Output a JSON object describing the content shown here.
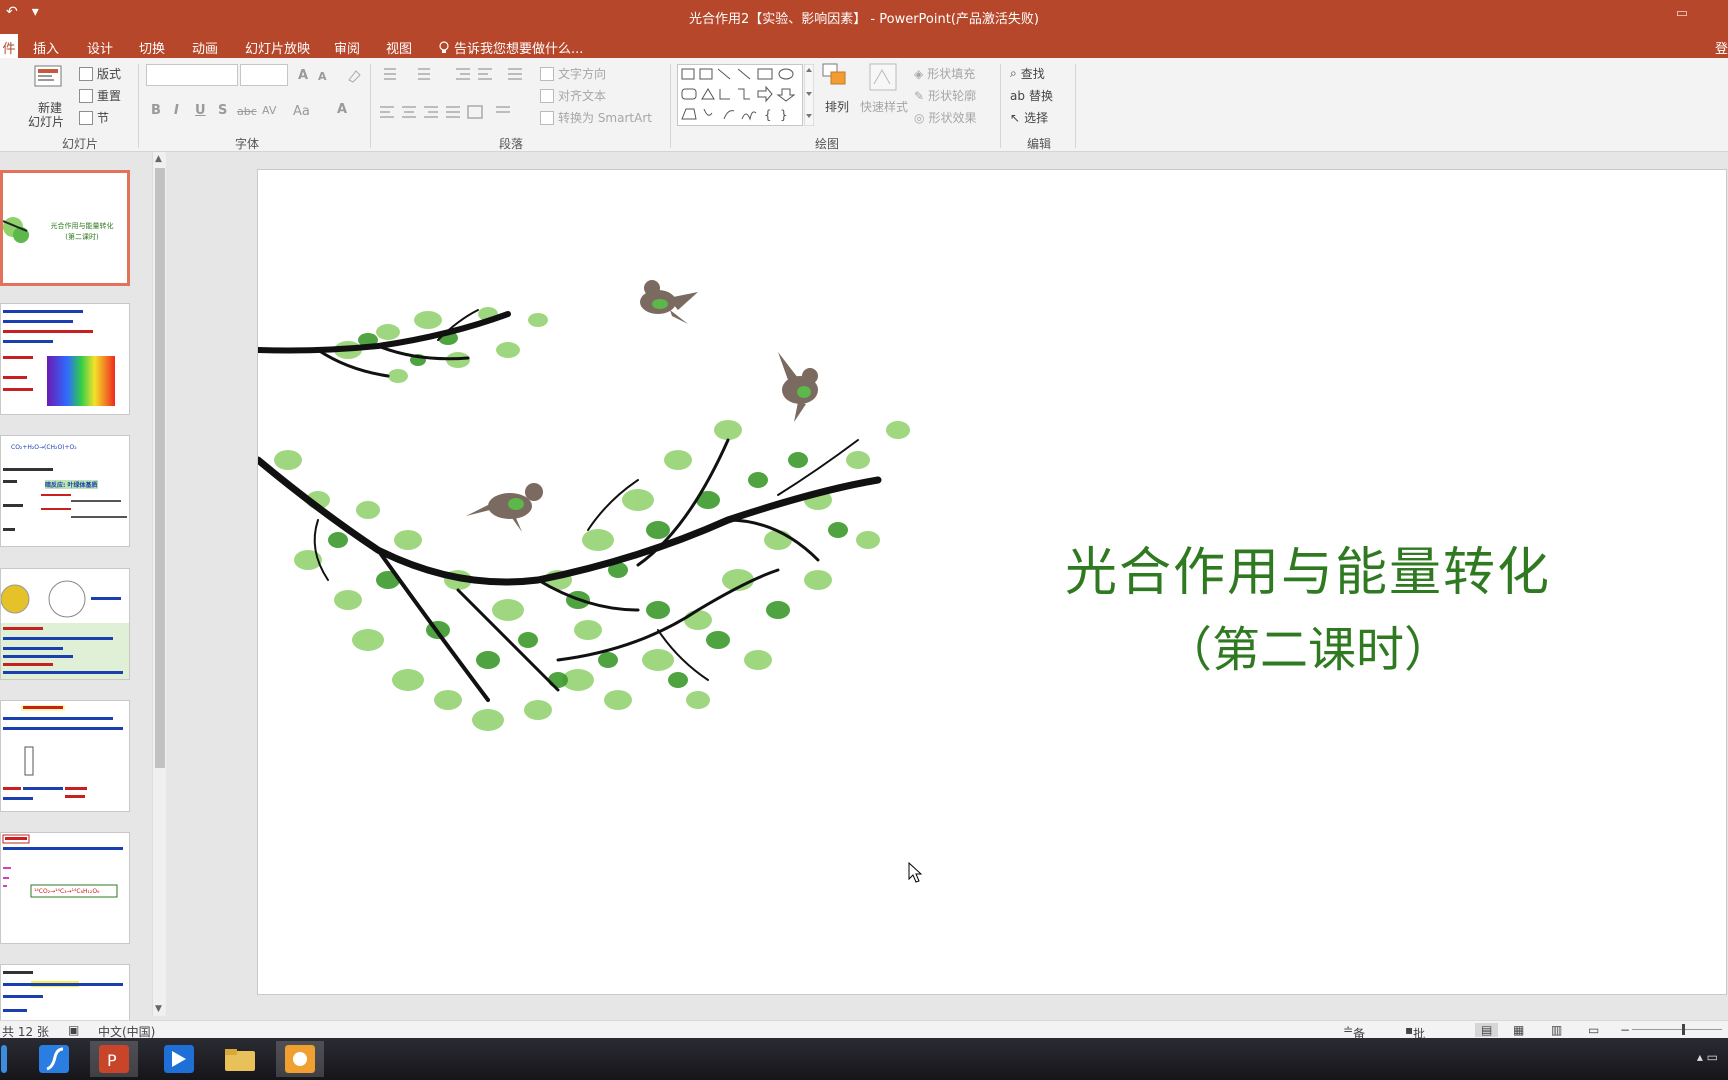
{
  "window": {
    "title": "光合作用2【实验、影响因素】 - PowerPoint(产品激活失败)",
    "qat_undo": "↶",
    "qat_more": "▾",
    "window_ctrl": "▭"
  },
  "tabs": {
    "active_partial": "件",
    "items": [
      "插入",
      "设计",
      "切换",
      "动画",
      "幻灯片放映",
      "审阅",
      "视图"
    ],
    "tell_me": "告诉我您想要做什么...",
    "login": "登"
  },
  "ribbon": {
    "slides_group": {
      "new_slide_line1": "新建",
      "new_slide_line2": "幻灯片",
      "layout": "版式",
      "reset": "重置",
      "section": "节",
      "label": "幻灯片"
    },
    "font_group": {
      "bold": "B",
      "italic": "I",
      "underline": "U",
      "shadow": "S",
      "strike": "abc",
      "spacing": "AV",
      "case": "Aa",
      "color": "A",
      "grow": "A",
      "shrink": "A",
      "label": "字体"
    },
    "paragraph_group": {
      "text_direction": "文字方向",
      "align_text": "对齐文本",
      "smartart": "转换为 SmartArt",
      "label": "段落"
    },
    "drawing_group": {
      "arrange": "排列",
      "quick_styles": "快速样式",
      "shape_fill": "形状填充",
      "shape_outline": "形状轮廓",
      "shape_effects": "形状效果",
      "label": "绘图"
    },
    "editing_group": {
      "find": "查找",
      "replace": "替换",
      "select": "选择",
      "label": "编辑"
    }
  },
  "slide": {
    "title_line1": "光合作用与能量转化",
    "title_line2": "（第二课时）",
    "title_color": "#2f7a21"
  },
  "thumbnails": {
    "t1_line1": "光合作用与能量转化",
    "t1_line2": "(第二课时)",
    "t3_formula": "CO₂+H₂O→(CH₂O)+O₂",
    "t3_heading": "暗反应: 叶绿体基质",
    "t6_formula": "¹⁴CO₂→¹⁴C₃→¹⁴C₆H₁₂O₆"
  },
  "status": {
    "slide_count": "共 12 张",
    "language": "中文(中国)",
    "notes": "备注",
    "comments": "批注"
  },
  "colors": {
    "accent": "#b7472a",
    "thumb_selected": "#e1735a"
  }
}
